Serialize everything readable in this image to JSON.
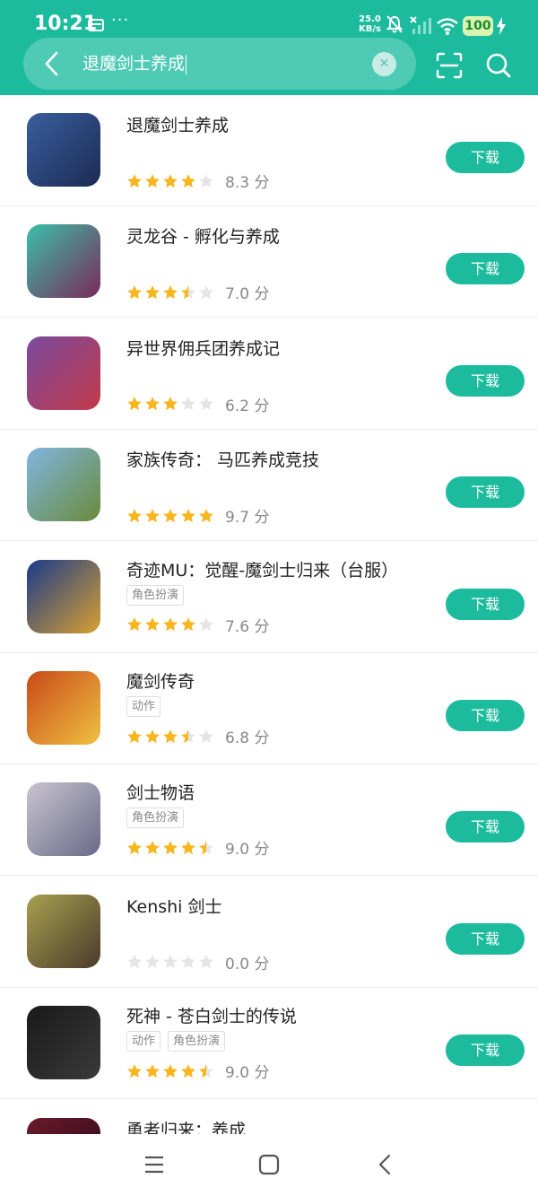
{
  "status_bar": {
    "time": "10:21",
    "more": "···",
    "net_speed_value": "25.0",
    "net_speed_unit": "KB/s",
    "battery": "100"
  },
  "search": {
    "query": "退魔剑士养成"
  },
  "download_label": "下载",
  "apps": [
    {
      "title": "退魔剑士养成",
      "tags": [],
      "stars": 4,
      "score": "8.3 分",
      "icon": "game-icon-exorcist",
      "colors": [
        "#3a5f9e",
        "#1b2a52"
      ]
    },
    {
      "title": "灵龙谷 - 孵化与养成",
      "tags": [],
      "stars": 3.5,
      "score": "7.0 分",
      "icon": "game-icon-dragon",
      "colors": [
        "#3bbfaa",
        "#7a2a5a"
      ]
    },
    {
      "title": "异世界佣兵团养成记",
      "tags": [],
      "stars": 3,
      "score": "6.2 分",
      "icon": "game-icon-mercenary",
      "colors": [
        "#7a4a9e",
        "#c23a4a"
      ]
    },
    {
      "title": "家族传奇： 马匹养成竞技",
      "tags": [],
      "stars": 5,
      "score": "9.7 分",
      "icon": "game-icon-horse",
      "colors": [
        "#7fb6e0",
        "#6a8a3a"
      ]
    },
    {
      "title": "奇迹MU：觉醒-魔剑士归来（台服）",
      "tags": [
        "角色扮演"
      ],
      "stars": 4,
      "score": "7.6 分",
      "icon": "game-icon-mu",
      "colors": [
        "#1a3a8a",
        "#d8a030"
      ]
    },
    {
      "title": "魔剑传奇",
      "tags": [
        "动作"
      ],
      "stars": 3.5,
      "score": "6.8 分",
      "icon": "game-icon-sword-legend",
      "colors": [
        "#c84a1a",
        "#f0c040"
      ]
    },
    {
      "title": "剑士物语",
      "tags": [
        "角色扮演"
      ],
      "stars": 4.5,
      "score": "9.0 分",
      "icon": "game-icon-swordsman",
      "colors": [
        "#c8c4d0",
        "#6a6a88"
      ]
    },
    {
      "title": "Kenshi 剑士",
      "tags": [],
      "stars": 0,
      "score": "0.0 分",
      "icon": "game-icon-kenshi",
      "colors": [
        "#a8a050",
        "#4a3a2a"
      ]
    },
    {
      "title": "死神 - 苍白剑士的传说",
      "tags": [
        "动作",
        "角色扮演"
      ],
      "stars": 4.5,
      "score": "9.0 分",
      "icon": "game-icon-reaper",
      "colors": [
        "#1a1a1a",
        "#3a3a3a"
      ]
    },
    {
      "title": "勇者归来：养成",
      "tags": [],
      "stars": 0,
      "score": "",
      "icon": "game-icon-hero",
      "colors": [
        "#6a1a2a",
        "#2a0a1a"
      ]
    }
  ],
  "colors": {
    "brand": "#1dbb9e",
    "star_filled": "#f7b51e",
    "star_empty": "#e5e5e5"
  }
}
